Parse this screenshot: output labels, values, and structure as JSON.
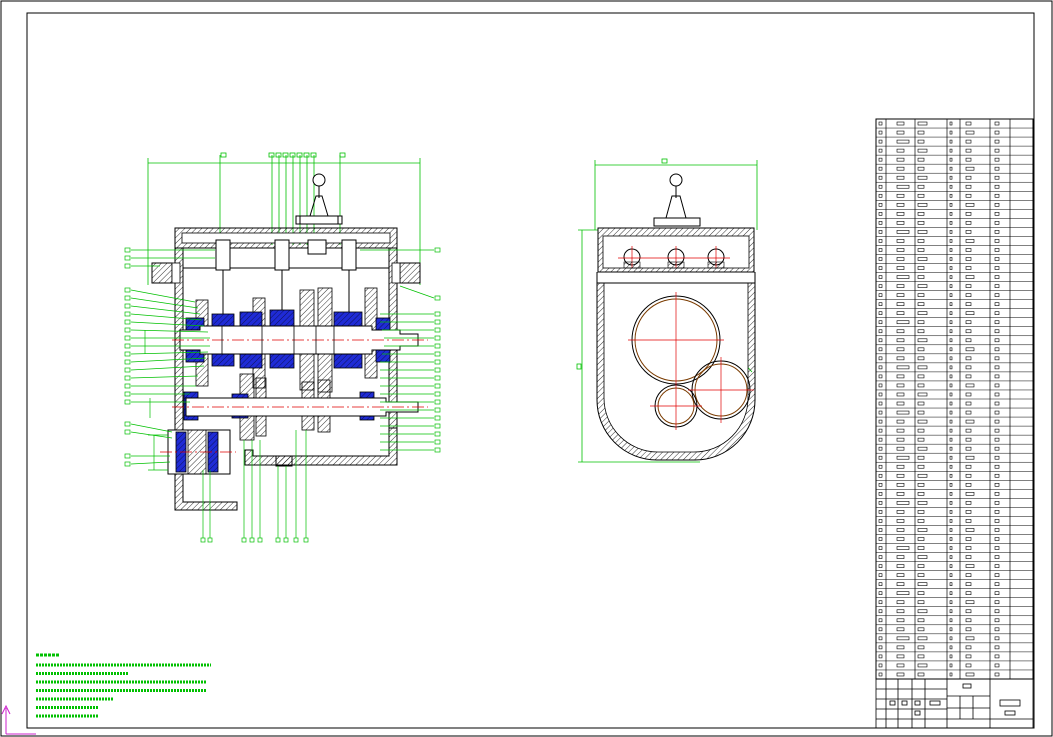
{
  "drawing": {
    "kind": "CAD assembly drawing",
    "views": [
      "front-section-view",
      "side-view"
    ],
    "colors": {
      "outline": "#000000",
      "dimension": "#00c000",
      "centerline": "#e00000",
      "section_fill": "#1f2bd6",
      "hatch": "#000000",
      "ucs": "#cc22cc",
      "background": "#ffffff"
    }
  },
  "parts_list": {
    "row_count": 62
  },
  "title_block": {},
  "technical_notes": {
    "line_count": 7
  }
}
